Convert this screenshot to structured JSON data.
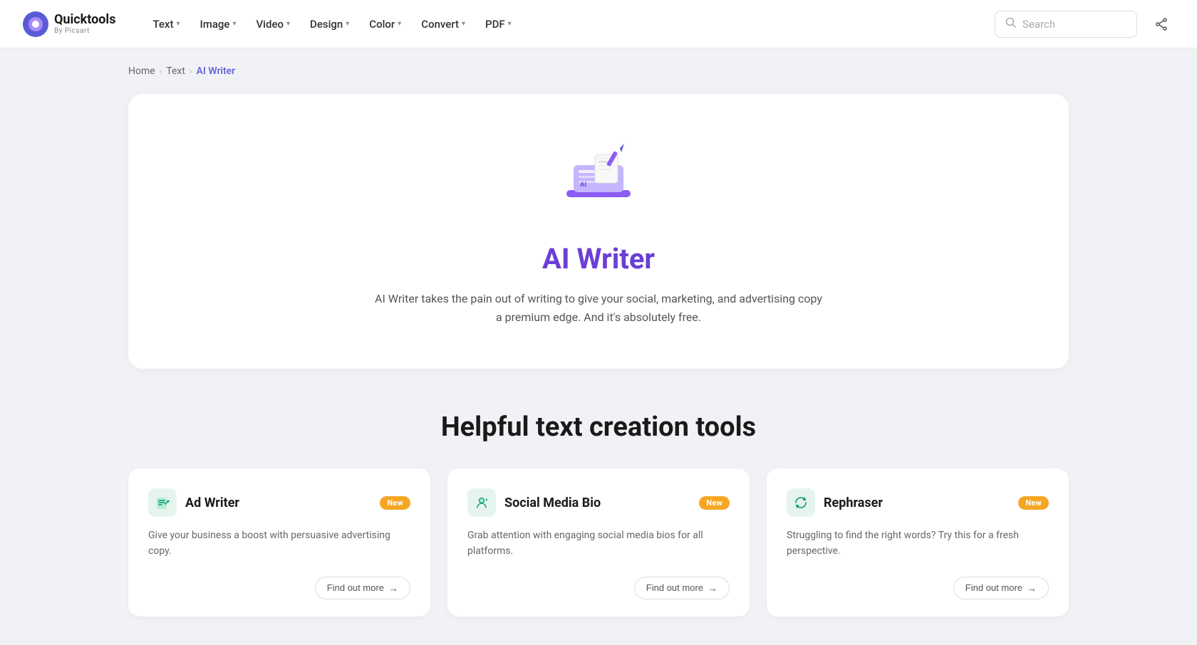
{
  "logo": {
    "quick": "Quicktools",
    "by": "By Picsart"
  },
  "nav": {
    "items": [
      {
        "label": "Text",
        "id": "text"
      },
      {
        "label": "Image",
        "id": "image"
      },
      {
        "label": "Video",
        "id": "video"
      },
      {
        "label": "Design",
        "id": "design"
      },
      {
        "label": "Color",
        "id": "color"
      },
      {
        "label": "Convert",
        "id": "convert"
      },
      {
        "label": "PDF",
        "id": "pdf"
      }
    ]
  },
  "search": {
    "placeholder": "Search"
  },
  "breadcrumb": {
    "home": "Home",
    "text": "Text",
    "current": "AI Writer"
  },
  "hero": {
    "title": "AI Writer",
    "desc": "AI Writer takes the pain out of writing to give your social, marketing, and advertising copy a premium edge. And it's absolutely free."
  },
  "section": {
    "title": "Helpful text creation tools"
  },
  "tools": [
    {
      "id": "ad-writer",
      "title": "Ad Writer",
      "badge": "New",
      "desc": "Give your business a boost with persuasive advertising copy.",
      "find_out": "Find out more",
      "icon_bg": "#e6f4ee",
      "icon_emoji": "✏️"
    },
    {
      "id": "social-media-bio",
      "title": "Social Media Bio",
      "badge": "New",
      "desc": "Grab attention with engaging social media bios for all platforms.",
      "find_out": "Find out more",
      "icon_bg": "#e6f4ee",
      "icon_emoji": "💬"
    },
    {
      "id": "rephraser",
      "title": "Rephraser",
      "badge": "New",
      "desc": "Struggling to find the right words? Try this for a fresh perspective.",
      "find_out": "Find out more",
      "icon_bg": "#e6f4ee",
      "icon_emoji": "🔄"
    }
  ]
}
